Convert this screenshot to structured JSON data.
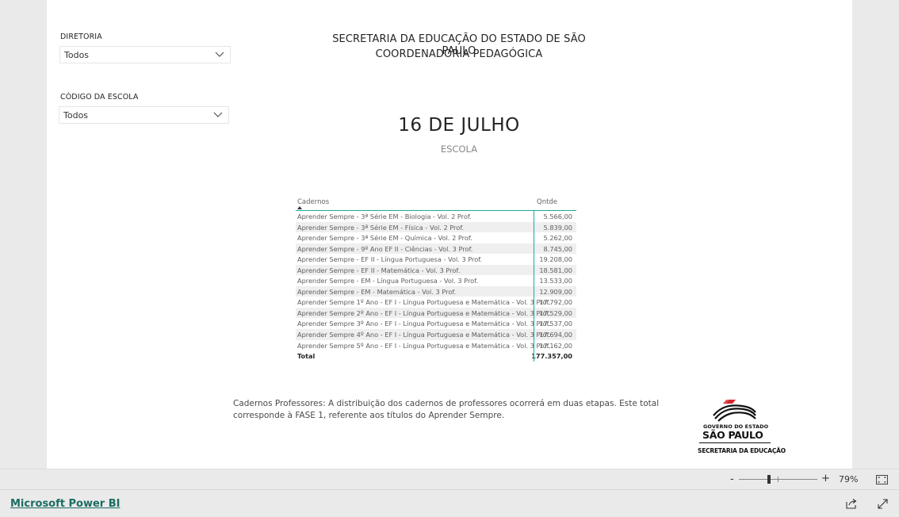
{
  "slicers": [
    {
      "label": "DIRETORIA",
      "value": "Todos"
    },
    {
      "label": "CÓDIGO DA ESCOLA",
      "value": "Todos"
    }
  ],
  "header": {
    "line1": "SECRETARIA DA EDUCAÇÃO DO ESTADO DE SÃO PAULO",
    "line2": "COORDENADORIA PEDAGÓGICA"
  },
  "card": {
    "value": "16 DE JULHO",
    "label": "ESCOLA"
  },
  "table": {
    "headers": [
      "Cadernos",
      "Qntde"
    ],
    "rows": [
      {
        "name": "Aprender Sempre - 3ª Série EM - Biologia - Vol. 2 Prof.",
        "qty": "5.566,00"
      },
      {
        "name": "Aprender Sempre - 3ª Série EM - Física - Vol. 2 Prof.",
        "qty": "5.839,00"
      },
      {
        "name": "Aprender Sempre - 3ª Série EM - Química - Vol. 2 Prof.",
        "qty": "5.262,00"
      },
      {
        "name": "Aprender Sempre - 9º Ano EF II - Ciências - Vol. 3 Prof.",
        "qty": "8.745,00"
      },
      {
        "name": "Aprender Sempre - EF II - Língua Portuguesa - Vol. 3 Prof.",
        "qty": "19.208,00"
      },
      {
        "name": "Aprender Sempre - EF II - Matemática - Vol. 3 Prof.",
        "qty": "18.581,00"
      },
      {
        "name": "Aprender Sempre - EM - Língua Portuguesa - Vol. 3 Prof.",
        "qty": "13.533,00"
      },
      {
        "name": "Aprender Sempre - EM - Matemática - Vol. 3 Prof.",
        "qty": "12.909,00"
      },
      {
        "name": "Aprender Sempre 1º Ano - EF I - Língua Portuguesa e Matemática - Vol. 3 Prof.",
        "qty": "17.792,00"
      },
      {
        "name": "Aprender Sempre 2º Ano - EF I - Língua Portuguesa e Matemática - Vol. 3 Prof.",
        "qty": "17.529,00"
      },
      {
        "name": "Aprender Sempre 3º Ano - EF I - Língua Portuguesa e Matemática - Vol. 3 Prof.",
        "qty": "17.537,00"
      },
      {
        "name": "Aprender Sempre 4º Ano - EF I - Língua Portuguesa e Matemática - Vol. 3 Prof.",
        "qty": "17.694,00"
      },
      {
        "name": "Aprender Sempre 5º Ano - EF I - Língua Portuguesa e Matemática - Vol. 3 Prof.",
        "qty": "17.162,00"
      }
    ],
    "total_label": "Total",
    "total_value": "177.357,00"
  },
  "note": "Cadernos Professores: A distribuição dos cadernos de professores ocorrerá em duas etapas. Este total corresponde à FASE 1, referente aos títulos do Aprender Sempre.",
  "logo": {
    "line1": "GOVERNO DO ESTADO",
    "line2": "SÃO PAULO",
    "line3": "SECRETARIA DA EDUCAÇÃO",
    "colors": {
      "red": "#d7262e",
      "black": "#111111"
    }
  },
  "zoom": {
    "minus": "-",
    "plus": "+",
    "percent": "79%",
    "level": 0.79
  },
  "footer": {
    "brand": "Microsoft Power BI"
  },
  "icons": [
    "chevron-down-icon",
    "fit-to-page-icon",
    "share-icon",
    "expand-icon",
    "sort-ascending-icon"
  ],
  "colors": {
    "accent": "#1aab9b",
    "brand_link": "#1a6d62"
  }
}
